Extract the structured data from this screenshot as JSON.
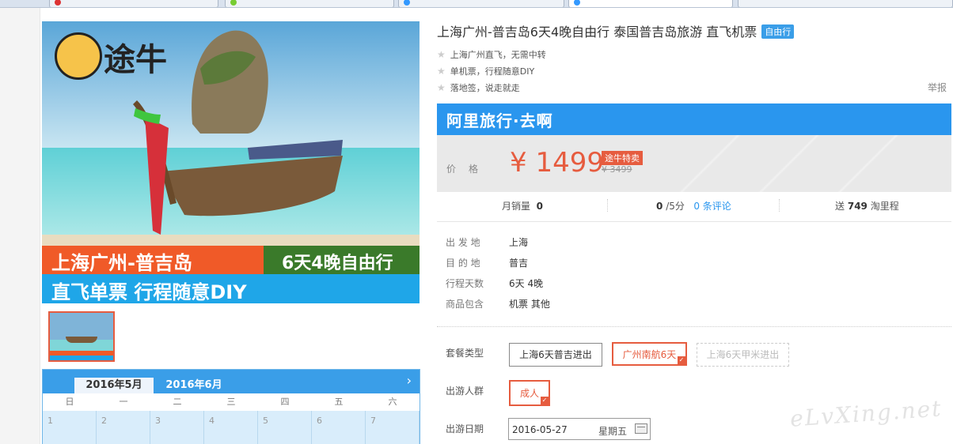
{
  "product": {
    "title": "上海广州-普吉岛6天4晚自由行 泰国普吉岛旅游 直飞机票",
    "tag": "自由行",
    "features": [
      "上海广州直飞，无需中转",
      "单机票，行程随意DIY",
      "落地签，说走就走"
    ],
    "report": "举报"
  },
  "hero": {
    "logo_text": "途牛",
    "banner_line1": "上海广州-普吉岛",
    "banner_line1_right": "6天4晚自由行",
    "banner_line2": "直飞单票 行程随意DIY"
  },
  "promo": {
    "bar_text": "阿里旅行·去啊",
    "price_label": "价格",
    "price": "¥ 1499",
    "tag": "途牛特卖",
    "original_price": "¥ 3499"
  },
  "stats": {
    "monthly_sales_label": "月销量",
    "monthly_sales": "0",
    "rating": "0",
    "rating_unit": "/5分",
    "reviews": "0 条评论",
    "points_prefix": "送",
    "points": "749",
    "points_suffix": "淘里程"
  },
  "info": [
    {
      "k": "出 发 地",
      "v": "上海"
    },
    {
      "k": "目 的 地",
      "v": "普吉"
    },
    {
      "k": "行程天数",
      "v": "6天 4晚"
    },
    {
      "k": "商品包含",
      "v": "机票  其他"
    }
  ],
  "options": {
    "package_label": "套餐类型",
    "packages": [
      "上海6天普吉进出",
      "广州南航6天",
      "上海6天甲米进出"
    ],
    "group_label": "出游人群",
    "group": "成人",
    "date_label": "出游日期",
    "date": "2016-05-27",
    "weekday": "星期五"
  },
  "calendar": {
    "month_active": "2016年5月",
    "month_next": "2016年6月",
    "next_arrow": "›",
    "weekdays": [
      "日",
      "一",
      "二",
      "三",
      "四",
      "五",
      "六"
    ],
    "days": [
      "1",
      "2",
      "3",
      "4",
      "5",
      "6",
      "7"
    ]
  },
  "watermark": "eLvXing.net"
}
